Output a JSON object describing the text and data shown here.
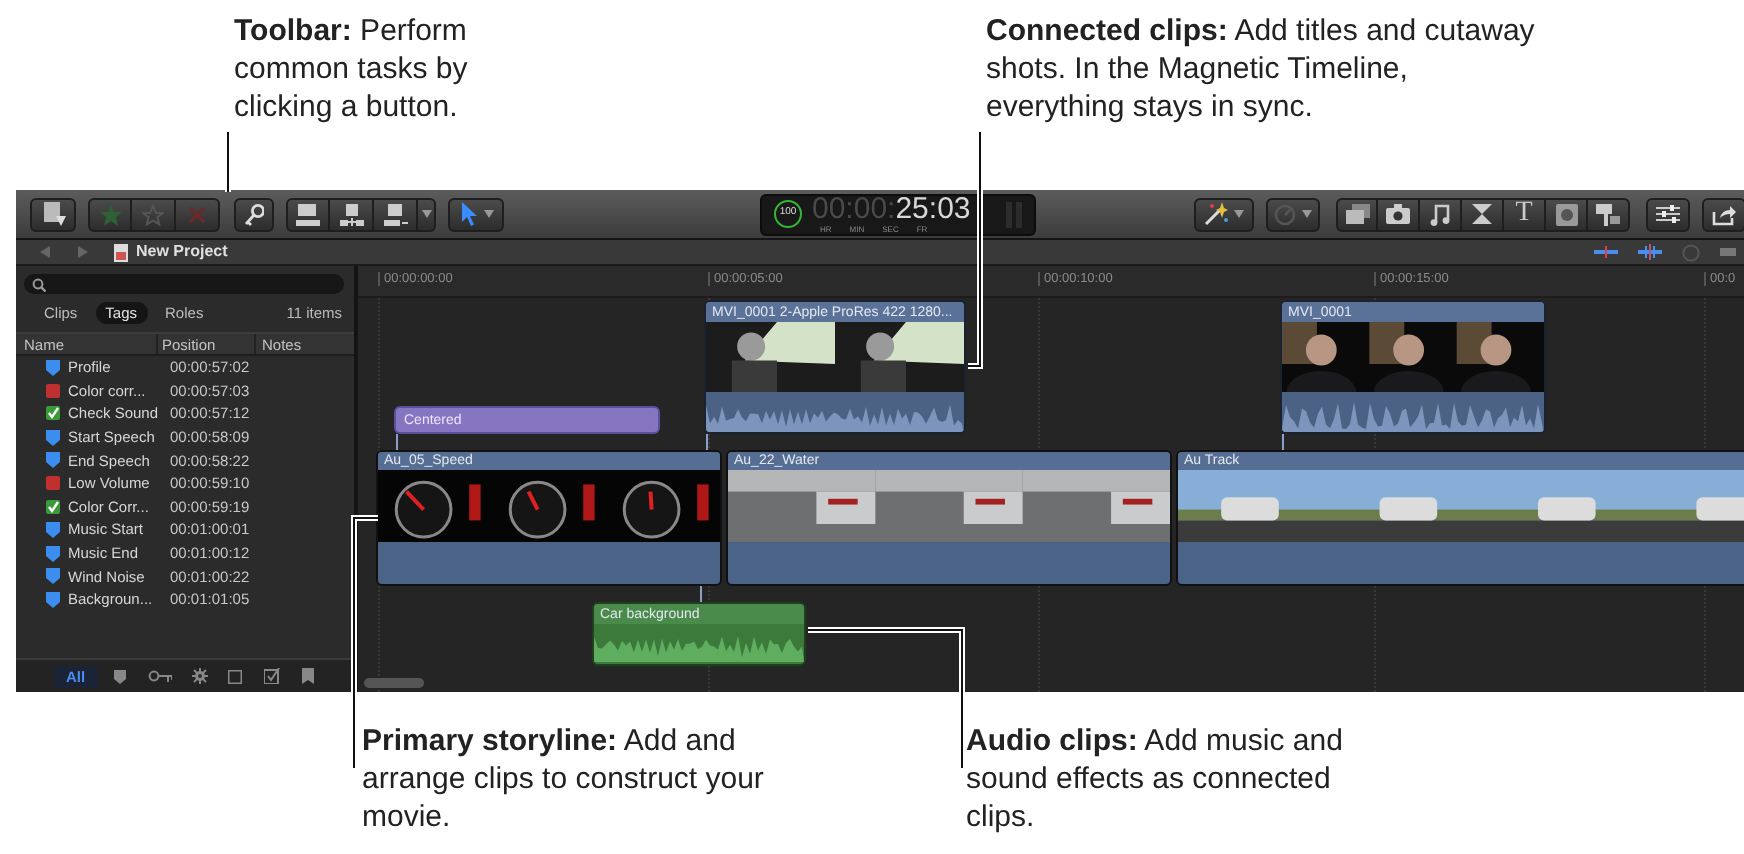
{
  "callouts": [
    {
      "text": "**Toolbar:** Perform common tasks by clicking a button."
    },
    {
      "text": "**Connected clips:** Add titles and cutaway shots. In the Magnetic Timeline, everything stays in sync."
    },
    {
      "text": "**Primary storyline:** Add and arrange clips to construct your movie."
    },
    {
      "text": "**Audio clips:** Add music and sound effects as connected clips."
    }
  ],
  "toolbar": {
    "zoom_level": "100",
    "timecode_dim": "00:00:",
    "timecode": "25:03",
    "timecode_units": [
      "HR",
      "MIN",
      "SEC",
      "FR"
    ],
    "title_glyph": "T"
  },
  "project": {
    "title": "New Project"
  },
  "index": {
    "tabs": [
      {
        "label": "Clips",
        "selected": false
      },
      {
        "label": "Tags",
        "selected": true
      },
      {
        "label": "Roles",
        "selected": false
      }
    ],
    "count": "11 items",
    "columns": [
      "Name",
      "Position",
      "Notes"
    ],
    "rows": [
      {
        "kind": "marker",
        "name": "Profile",
        "position": "00:00:57:02"
      },
      {
        "kind": "todo",
        "name": "Color corr...",
        "position": "00:00:57:03"
      },
      {
        "kind": "completed",
        "name": "Check Sound",
        "position": "00:00:57:12"
      },
      {
        "kind": "marker",
        "name": "Start Speech",
        "position": "00:00:58:09"
      },
      {
        "kind": "marker",
        "name": "End Speech",
        "position": "00:00:58:22"
      },
      {
        "kind": "todo",
        "name": "Low Volume",
        "position": "00:00:59:10"
      },
      {
        "kind": "completed",
        "name": "Color Corr...",
        "position": "00:00:59:19"
      },
      {
        "kind": "marker",
        "name": "Music Start",
        "position": "00:01:00:01"
      },
      {
        "kind": "marker",
        "name": "Music End",
        "position": "00:01:00:12"
      },
      {
        "kind": "marker",
        "name": "Wind Noise",
        "position": "00:01:00:22"
      },
      {
        "kind": "marker",
        "name": "Backgroun...",
        "position": "00:01:01:05"
      }
    ],
    "filters": [
      {
        "kind": "all",
        "label": "All",
        "selected": true
      },
      {
        "kind": "marker",
        "selected": false
      },
      {
        "kind": "keyword",
        "selected": false
      },
      {
        "kind": "analysis",
        "selected": false
      },
      {
        "kind": "chapter",
        "selected": false
      },
      {
        "kind": "todo",
        "selected": false
      },
      {
        "kind": "flag",
        "selected": false
      }
    ]
  },
  "timeline": {
    "ruler": [
      "00:00:00:00",
      "00:00:05:00",
      "00:00:10:00",
      "00:00:15:00",
      "00:0"
    ],
    "clips": [
      {
        "kind": "video",
        "title": "MVI_0001 2-Apple ProRes 422 1280..."
      },
      {
        "kind": "video",
        "title": "MVI_0001"
      },
      {
        "kind": "title",
        "title": "Centered"
      },
      {
        "kind": "primary",
        "title": "Au_05_Speed"
      },
      {
        "kind": "primary",
        "title": "Au_22_Water"
      },
      {
        "kind": "primary",
        "title": "Au Track"
      },
      {
        "kind": "audio",
        "title": "Car background"
      }
    ]
  }
}
